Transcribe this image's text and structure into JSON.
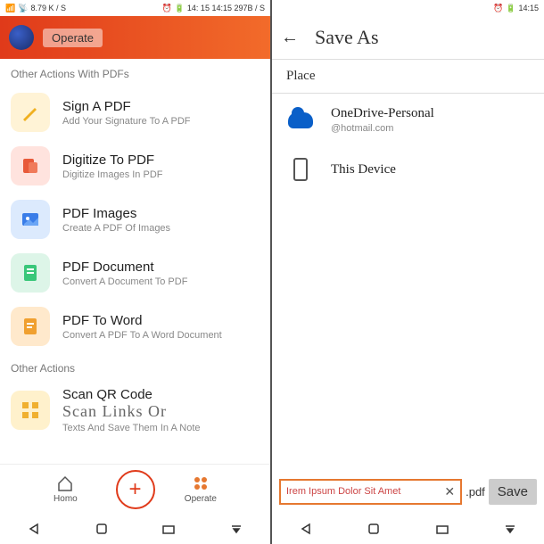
{
  "left": {
    "status": {
      "net": "8.79 K / S",
      "time_center": "14: 15 14:15 297B / S"
    },
    "header": {
      "tab": "Operate"
    },
    "section1_title": "Other Actions With PDFs",
    "actions": [
      {
        "title": "Sign A PDF",
        "sub": "Add Your Signature To A PDF"
      },
      {
        "title": "Digitize To PDF",
        "sub": "Digitize Images In PDF"
      },
      {
        "title": "PDF Images",
        "sub": "Create A PDF Of Images"
      },
      {
        "title": "PDF Document",
        "sub": "Convert A Document To PDF"
      },
      {
        "title": "PDF To Word",
        "sub": "Convert A PDF To A Word Document"
      }
    ],
    "section2_title": "Other Actions",
    "scan": {
      "title": "Scan QR Code",
      "big": "Scan Links Or",
      "sub": "Texts And Save Them In A Note"
    },
    "nav": {
      "home": "Homo",
      "operate": "Operate"
    }
  },
  "right": {
    "status": {
      "time": "14:15"
    },
    "title": "Save As",
    "place_label": "Place",
    "places": [
      {
        "title": "OneDrive-Personal",
        "sub": "@hotmail.com"
      },
      {
        "title": "This Device",
        "sub": ""
      }
    ],
    "filename": "Irem Ipsum Dolor Sit Amet",
    "ext": ".pdf",
    "save_btn": "Save"
  }
}
